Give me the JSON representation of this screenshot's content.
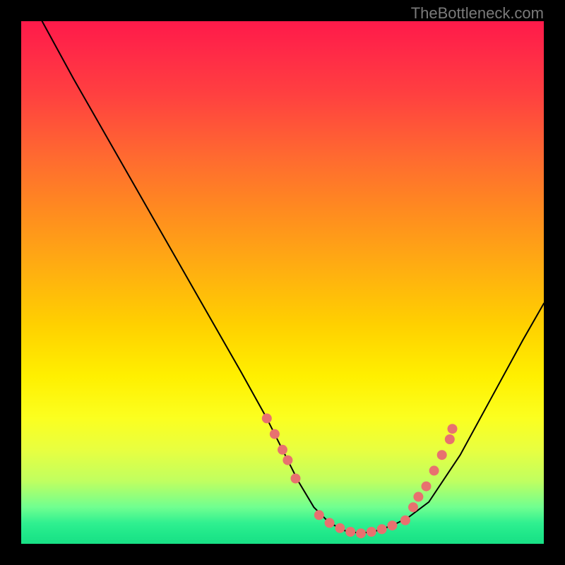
{
  "watermark": "TheBottleneck.com",
  "chart_data": {
    "type": "line",
    "title": "",
    "xlabel": "",
    "ylabel": "",
    "xlim": [
      0,
      100
    ],
    "ylim": [
      0,
      100
    ],
    "series": [
      {
        "name": "bottleneck-curve",
        "x": [
          4,
          10,
          18,
          26,
          34,
          42,
          47,
          50,
          53,
          56,
          59,
          62,
          65,
          68,
          71,
          74,
          78,
          84,
          90,
          96,
          100
        ],
        "y": [
          100,
          89,
          75,
          61,
          47,
          33,
          24,
          18,
          12,
          7,
          4,
          2.5,
          2,
          2.5,
          3.5,
          5,
          8,
          17,
          28,
          39,
          46
        ],
        "color": "#000000"
      }
    ],
    "markers": {
      "name": "highlight-dots",
      "color": "#e8716f",
      "points": [
        {
          "x": 47,
          "y": 24
        },
        {
          "x": 48.5,
          "y": 21
        },
        {
          "x": 50,
          "y": 18
        },
        {
          "x": 51,
          "y": 16
        },
        {
          "x": 52.5,
          "y": 12.5
        },
        {
          "x": 57,
          "y": 5.5
        },
        {
          "x": 59,
          "y": 4
        },
        {
          "x": 61,
          "y": 3
        },
        {
          "x": 63,
          "y": 2.3
        },
        {
          "x": 65,
          "y": 2
        },
        {
          "x": 67,
          "y": 2.3
        },
        {
          "x": 69,
          "y": 2.8
        },
        {
          "x": 71,
          "y": 3.5
        },
        {
          "x": 73.5,
          "y": 4.5
        },
        {
          "x": 75,
          "y": 7
        },
        {
          "x": 76,
          "y": 9
        },
        {
          "x": 77.5,
          "y": 11
        },
        {
          "x": 79,
          "y": 14
        },
        {
          "x": 80.5,
          "y": 17
        },
        {
          "x": 82,
          "y": 20
        },
        {
          "x": 82.5,
          "y": 22
        }
      ]
    }
  }
}
